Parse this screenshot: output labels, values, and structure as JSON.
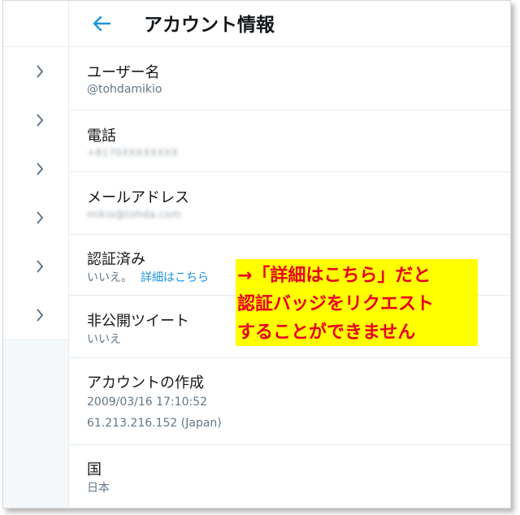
{
  "header": {
    "title": "アカウント情報"
  },
  "sidebar": {
    "chevron_count": 6
  },
  "rows": {
    "username": {
      "label": "ユーザー名",
      "value": "@tohdamikio"
    },
    "phone": {
      "label": "電話",
      "value": "+8170XXXXXXXX"
    },
    "email": {
      "label": "メールアドレス",
      "value": "mikio@tohda.com"
    },
    "verified": {
      "label": "認証済み",
      "value": "いいえ。",
      "link": "詳細はこちら"
    },
    "protected": {
      "label": "非公開ツイート",
      "value": "いいえ"
    },
    "created": {
      "label": "アカウントの作成",
      "date": "2009/03/16 17:10:52",
      "ip": "61.213.216.152 (Japan)"
    },
    "country": {
      "label": "国",
      "value": "日本"
    }
  },
  "annotation": {
    "line1": "→「詳細はこちら」だと",
    "line2": "認証バッジをリクエスト",
    "line3": "することができません"
  },
  "colors": {
    "accent": "#1b95e0",
    "annotation_bg": "#ffff00",
    "annotation_text": "#e8001c"
  },
  "icons": {
    "back": "back-arrow-icon",
    "chevron": "chevron-right-icon"
  }
}
